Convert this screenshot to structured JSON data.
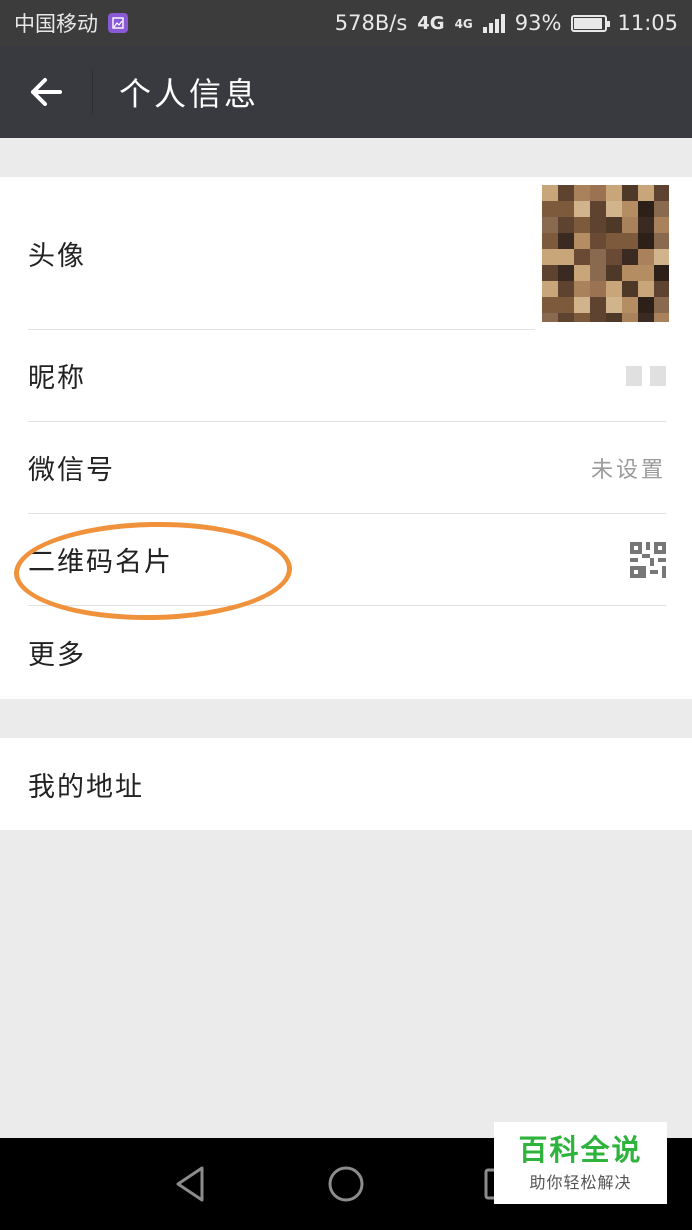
{
  "status_bar": {
    "carrier": "中国移动",
    "net_speed": "578B/s",
    "network_a": "4G",
    "network_b": "4G",
    "battery": "93%",
    "battery_level": 0.93,
    "time": "11:05"
  },
  "app_bar": {
    "title": "个人信息",
    "back_icon": "arrow-left-icon"
  },
  "profile": {
    "avatar_label": "头像",
    "nickname_label": "昵称",
    "wechat_id_label": "微信号",
    "wechat_id_value": "未设置",
    "qr_label": "二维码名片",
    "qr_icon": "qr-code-icon",
    "more_label": "更多"
  },
  "address": {
    "label": "我的地址"
  },
  "nav_bar": {
    "back_icon": "triangle-back-icon",
    "home_icon": "circle-home-icon",
    "recent_icon": "square-recent-icon"
  },
  "watermark": {
    "title": "百科全说",
    "subtitle": "助你轻松解决"
  },
  "colors": {
    "app_bar": "#393a3f",
    "status_bar": "#3c3c3c",
    "annotation": "#f0923b",
    "watermark_green": "#2eb43d"
  }
}
